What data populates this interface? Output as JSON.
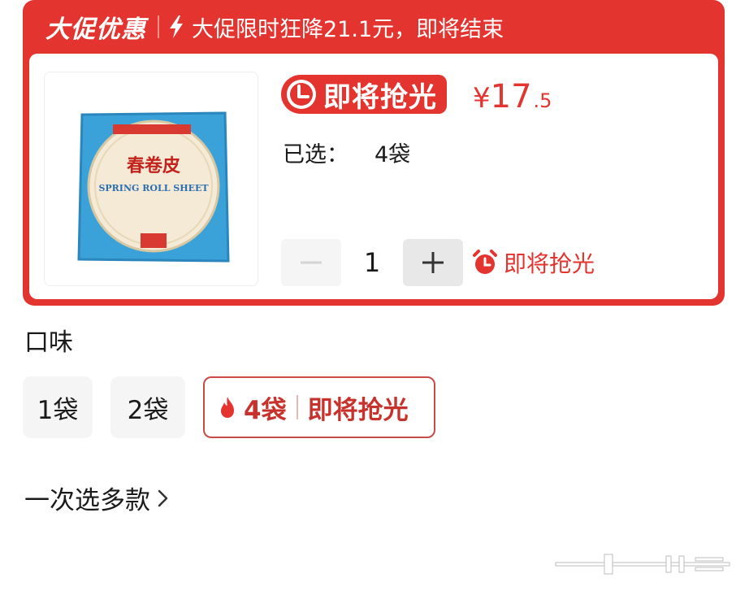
{
  "promo": {
    "title": "大促优惠",
    "description": "大促限时狂降21.1元，即将结束"
  },
  "product": {
    "image_label_cn": "春卷皮",
    "image_label_en": "SPRING ROLL SHEET",
    "badge": "即将抢光",
    "price_symbol": "¥",
    "price_int": "17",
    "price_dec": ".5",
    "selected_label": "已选：",
    "selected_value": "4袋"
  },
  "quantity": {
    "minus": "−",
    "value": "1",
    "plus": "+",
    "hint": "即将抢光"
  },
  "flavor": {
    "label": "口味",
    "options": [
      {
        "label": "1袋"
      },
      {
        "label": "2袋"
      },
      {
        "label": "4袋",
        "hint": "即将抢光",
        "selected": true
      }
    ]
  },
  "multi_select": {
    "label": "一次选多款"
  },
  "colors": {
    "accent": "#e3342f",
    "selected_border": "#c94a46"
  }
}
